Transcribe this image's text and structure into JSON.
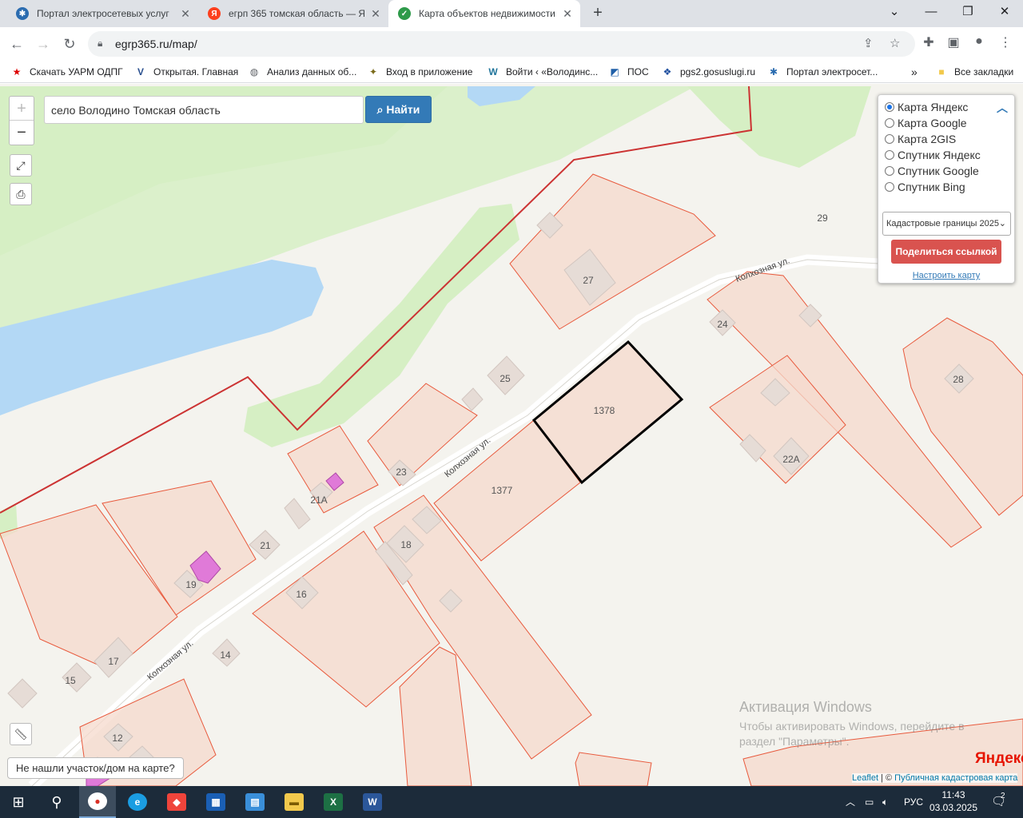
{
  "browser": {
    "tabs": [
      {
        "title": "Портал электросетевых услуг",
        "active": false
      },
      {
        "title": "егрп 365 томская область — Яндекс",
        "active": false
      },
      {
        "title": "Карта объектов недвижимости",
        "active": true
      }
    ],
    "url": "egrp365.ru/map/",
    "bookmarks": [
      {
        "label": "Скачать УАРМ ОДПГ"
      },
      {
        "label": "Открытая. Главная"
      },
      {
        "label": "Анализ данных об..."
      },
      {
        "label": "Вход в приложение"
      },
      {
        "label": "Войти ‹ «Володинс..."
      },
      {
        "label": "ПОС"
      },
      {
        "label": "pgs2.gosuslugi.ru"
      },
      {
        "label": "Портал электросет..."
      }
    ],
    "all_bookmarks": "Все закладки",
    "more": "»"
  },
  "map": {
    "search_value": "село Володино Томская область",
    "search_button": "Найти",
    "layers": [
      {
        "label": "Карта Яндекс",
        "selected": true
      },
      {
        "label": "Карта Google",
        "selected": false
      },
      {
        "label": "Карта 2GIS",
        "selected": false
      },
      {
        "label": "Спутник Яндекс",
        "selected": false
      },
      {
        "label": "Спутник Google",
        "selected": false
      },
      {
        "label": "Спутник Bing",
        "selected": false
      }
    ],
    "cadastre_select": "Кадастровые границы 2025",
    "share_button": "Поделиться ссылкой",
    "configure_link": "Настроить карту",
    "not_found_button": "Не нашли участок/дом на карте?",
    "street_name": "Колхозная ул.",
    "labels": {
      "p1378": "1378",
      "p1377": "1377",
      "h27": "27",
      "h29": "29",
      "h25": "25",
      "h24": "24",
      "h28": "28",
      "h23": "23",
      "h21a": "21А",
      "h21": "21",
      "h22a": "22А",
      "h19": "19",
      "h18": "18",
      "h16": "16",
      "h17": "17",
      "h15": "15",
      "h14": "14",
      "h12": "12"
    },
    "yandex_logo": "Яндекс",
    "attribution": {
      "leaflet": "Leaflet",
      "sep": " | © ",
      "pkk": "Публичная кадастровая карта"
    },
    "activation_title": "Активация Windows",
    "activation_text1": "Чтобы активировать Windows, перейдите в",
    "activation_text2": "раздел \"Параметры\"."
  },
  "taskbar": {
    "lang": "РУС",
    "time": "11:43",
    "date": "03.03.2025",
    "notifications": "2"
  },
  "colors": {
    "parcel_fill": "#f5d9cc",
    "parcel_stroke": "#e8593c",
    "selected_stroke": "#000000",
    "water": "#b3d8f5",
    "park": "#d6efc4",
    "boundary": "#cc3333",
    "accent_blue": "#337ab7",
    "share_red": "#d9534f"
  }
}
